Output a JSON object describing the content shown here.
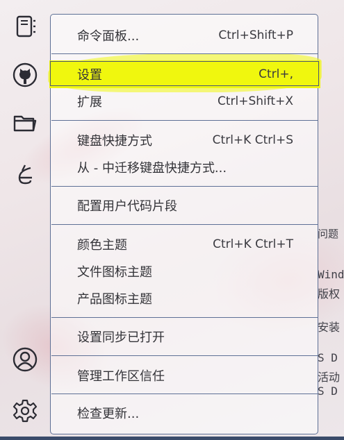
{
  "menu": {
    "items": [
      {
        "label": "命令面板...",
        "shortcut": "Ctrl+Shift+P"
      },
      {
        "label": "设置",
        "shortcut": "Ctrl+,"
      },
      {
        "label": "扩展",
        "shortcut": "Ctrl+Shift+X"
      },
      {
        "label": "键盘快捷方式",
        "shortcut": "Ctrl+K Ctrl+S"
      },
      {
        "label": "从 - 中迁移键盘快捷方式...",
        "shortcut": ""
      },
      {
        "label": "配置用户代码片段",
        "shortcut": ""
      },
      {
        "label": "颜色主题",
        "shortcut": "Ctrl+K Ctrl+T"
      },
      {
        "label": "文件图标主题",
        "shortcut": ""
      },
      {
        "label": "产品图标主题",
        "shortcut": ""
      },
      {
        "label": "设置同步已打开",
        "shortcut": ""
      },
      {
        "label": "管理工作区信任",
        "shortcut": ""
      },
      {
        "label": "检查更新...",
        "shortcut": ""
      }
    ]
  },
  "activity_bar": {
    "icons": [
      "notebook-icon",
      "github-icon",
      "folder-icon",
      "git-branch-icon",
      "account-icon",
      "gear-icon"
    ]
  },
  "background_text": {
    "line1": "问题",
    "line2": "Wind",
    "line3": "版权",
    "line4": "安装",
    "line5": "S D",
    "line6": "活动",
    "line7": "S D"
  },
  "colors": {
    "highlight": "#f0f70e",
    "menu_border": "#5d6f95"
  }
}
